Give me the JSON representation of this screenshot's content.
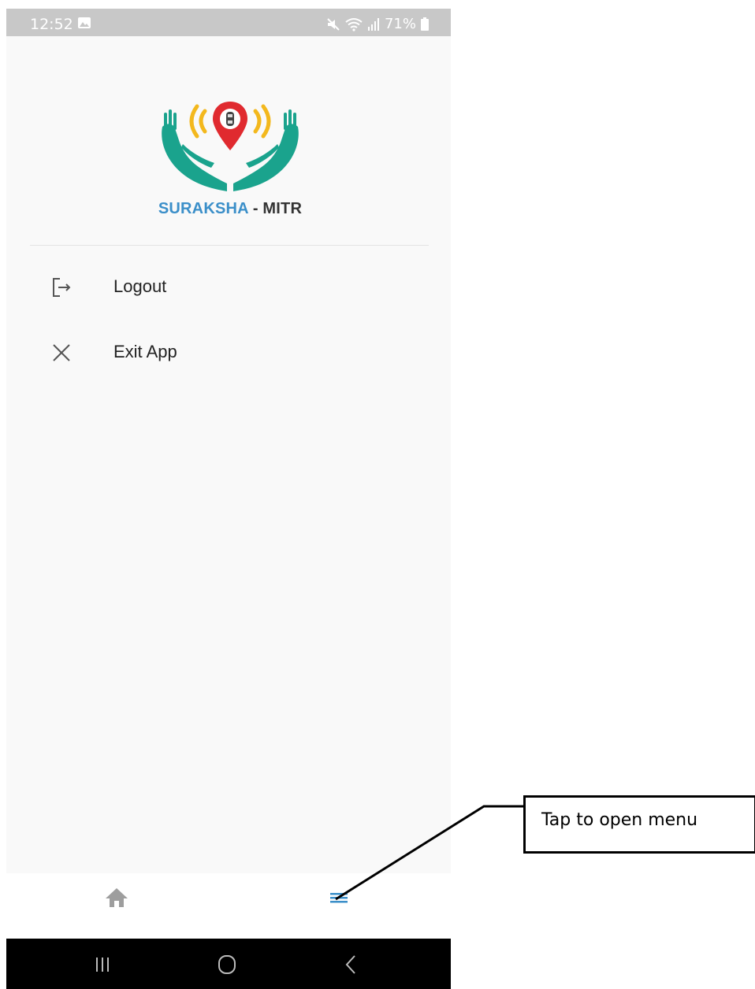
{
  "status_bar": {
    "time": "12:52",
    "battery": "71%",
    "icons": [
      "gallery-icon",
      "mute-icon",
      "wifi-icon",
      "signal-icon",
      "battery-icon"
    ]
  },
  "logo": {
    "word_part1": "SURAKSHA",
    "word_part2": " - MITR",
    "colors": {
      "hands": "#1aa38d",
      "pin": "#e02a2f",
      "waves": "#f3b81d",
      "blue": "#3b8fc9"
    }
  },
  "menu": {
    "items": [
      {
        "label": "Logout",
        "icon": "logout-icon"
      },
      {
        "label": "Exit App",
        "icon": "close-icon"
      }
    ]
  },
  "bottom_nav": {
    "items": [
      {
        "icon": "home-icon",
        "color": "#9e9e9e"
      },
      {
        "icon": "menu-icon",
        "color": "#3b8fc9",
        "active": true
      }
    ]
  },
  "system_nav": [
    "recent-apps-icon",
    "home-circle-icon",
    "back-icon"
  ],
  "callout": {
    "text": "Tap to open menu"
  }
}
